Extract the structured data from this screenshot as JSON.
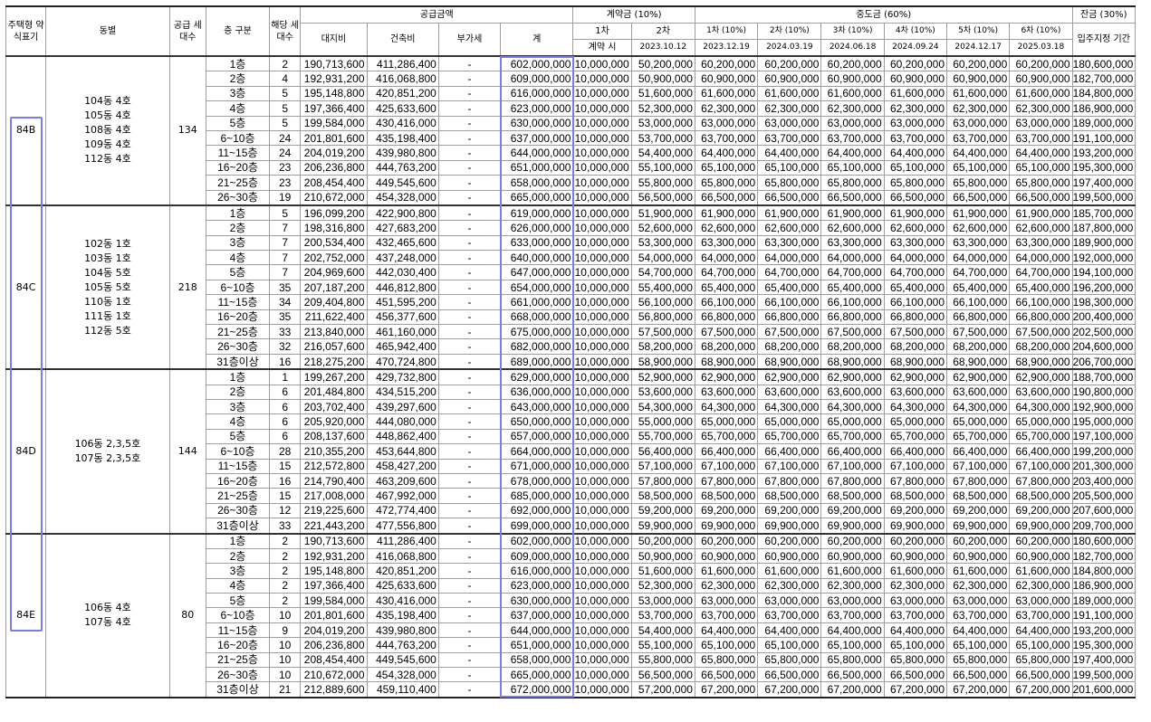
{
  "headers": {
    "type": "주택형 약식표기",
    "dong": "동별",
    "supply_units": "공급 세대수",
    "floor": "층 구분",
    "units": "해당 세대수",
    "supply_price": "공급금액",
    "land": "대지비",
    "building": "건축비",
    "vat": "부가세",
    "total": "계",
    "deposit": "계약금 (10%)",
    "deposit_1": "1차",
    "deposit_1_when": "계약 시",
    "deposit_2": "2차",
    "deposit_2_date": "2023.10.12",
    "interim": "중도금 (60%)",
    "interim_terms": [
      "1차 (10%)",
      "2차 (10%)",
      "3차 (10%)",
      "4차 (10%)",
      "5차 (10%)",
      "6차 (10%)"
    ],
    "interim_dates": [
      "2023.12.19",
      "2024.03.19",
      "2024.06.18",
      "2024.09.24",
      "2024.12.17",
      "2025.03.18"
    ],
    "balance": "잔금 (30%)",
    "balance_when": "입주지정 기간"
  },
  "groups": [
    {
      "type": "84B",
      "dongs": [
        "104동 4호",
        "105동 4호",
        "108동 4호",
        "109동 4호",
        "112동 4호"
      ],
      "supply_units": "134",
      "rows": [
        [
          "1층",
          "2",
          "190,713,600",
          "411,286,400",
          "-",
          "602,000,000",
          "10,000,000",
          "50,200,000",
          "60,200,000",
          "60,200,000",
          "60,200,000",
          "60,200,000",
          "60,200,000",
          "60,200,000",
          "180,600,000"
        ],
        [
          "2층",
          "4",
          "192,931,200",
          "416,068,800",
          "-",
          "609,000,000",
          "10,000,000",
          "50,900,000",
          "60,900,000",
          "60,900,000",
          "60,900,000",
          "60,900,000",
          "60,900,000",
          "60,900,000",
          "182,700,000"
        ],
        [
          "3층",
          "5",
          "195,148,800",
          "420,851,200",
          "-",
          "616,000,000",
          "10,000,000",
          "51,600,000",
          "61,600,000",
          "61,600,000",
          "61,600,000",
          "61,600,000",
          "61,600,000",
          "61,600,000",
          "184,800,000"
        ],
        [
          "4층",
          "5",
          "197,366,400",
          "425,633,600",
          "-",
          "623,000,000",
          "10,000,000",
          "52,300,000",
          "62,300,000",
          "62,300,000",
          "62,300,000",
          "62,300,000",
          "62,300,000",
          "62,300,000",
          "186,900,000"
        ],
        [
          "5층",
          "5",
          "199,584,000",
          "430,416,000",
          "-",
          "630,000,000",
          "10,000,000",
          "53,000,000",
          "63,000,000",
          "63,000,000",
          "63,000,000",
          "63,000,000",
          "63,000,000",
          "63,000,000",
          "189,000,000"
        ],
        [
          "6~10층",
          "24",
          "201,801,600",
          "435,198,400",
          "-",
          "637,000,000",
          "10,000,000",
          "53,700,000",
          "63,700,000",
          "63,700,000",
          "63,700,000",
          "63,700,000",
          "63,700,000",
          "63,700,000",
          "191,100,000"
        ],
        [
          "11~15층",
          "24",
          "204,019,200",
          "439,980,800",
          "-",
          "644,000,000",
          "10,000,000",
          "54,400,000",
          "64,400,000",
          "64,400,000",
          "64,400,000",
          "64,400,000",
          "64,400,000",
          "64,400,000",
          "193,200,000"
        ],
        [
          "16~20층",
          "23",
          "206,236,800",
          "444,763,200",
          "-",
          "651,000,000",
          "10,000,000",
          "55,100,000",
          "65,100,000",
          "65,100,000",
          "65,100,000",
          "65,100,000",
          "65,100,000",
          "65,100,000",
          "195,300,000"
        ],
        [
          "21~25층",
          "23",
          "208,454,400",
          "449,545,600",
          "-",
          "658,000,000",
          "10,000,000",
          "55,800,000",
          "65,800,000",
          "65,800,000",
          "65,800,000",
          "65,800,000",
          "65,800,000",
          "65,800,000",
          "197,400,000"
        ],
        [
          "26~30층",
          "19",
          "210,672,000",
          "454,328,000",
          "-",
          "665,000,000",
          "10,000,000",
          "56,500,000",
          "66,500,000",
          "66,500,000",
          "66,500,000",
          "66,500,000",
          "66,500,000",
          "66,500,000",
          "199,500,000"
        ]
      ]
    },
    {
      "type": "84C",
      "dongs": [
        "102동 1호",
        "103동 1호",
        "104동 5호",
        "105동 5호",
        "110동 1호",
        "111동 1호",
        "112동 5호"
      ],
      "supply_units": "218",
      "rows": [
        [
          "1층",
          "5",
          "196,099,200",
          "422,900,800",
          "-",
          "619,000,000",
          "10,000,000",
          "51,900,000",
          "61,900,000",
          "61,900,000",
          "61,900,000",
          "61,900,000",
          "61,900,000",
          "61,900,000",
          "185,700,000"
        ],
        [
          "2층",
          "7",
          "198,316,800",
          "427,683,200",
          "-",
          "626,000,000",
          "10,000,000",
          "52,600,000",
          "62,600,000",
          "62,600,000",
          "62,600,000",
          "62,600,000",
          "62,600,000",
          "62,600,000",
          "187,800,000"
        ],
        [
          "3층",
          "7",
          "200,534,400",
          "432,465,600",
          "-",
          "633,000,000",
          "10,000,000",
          "53,300,000",
          "63,300,000",
          "63,300,000",
          "63,300,000",
          "63,300,000",
          "63,300,000",
          "63,300,000",
          "189,900,000"
        ],
        [
          "4층",
          "7",
          "202,752,000",
          "437,248,000",
          "-",
          "640,000,000",
          "10,000,000",
          "54,000,000",
          "64,000,000",
          "64,000,000",
          "64,000,000",
          "64,000,000",
          "64,000,000",
          "64,000,000",
          "192,000,000"
        ],
        [
          "5층",
          "7",
          "204,969,600",
          "442,030,400",
          "-",
          "647,000,000",
          "10,000,000",
          "54,700,000",
          "64,700,000",
          "64,700,000",
          "64,700,000",
          "64,700,000",
          "64,700,000",
          "64,700,000",
          "194,100,000"
        ],
        [
          "6~10층",
          "35",
          "207,187,200",
          "446,812,800",
          "-",
          "654,000,000",
          "10,000,000",
          "55,400,000",
          "65,400,000",
          "65,400,000",
          "65,400,000",
          "65,400,000",
          "65,400,000",
          "65,400,000",
          "196,200,000"
        ],
        [
          "11~15층",
          "34",
          "209,404,800",
          "451,595,200",
          "-",
          "661,000,000",
          "10,000,000",
          "56,100,000",
          "66,100,000",
          "66,100,000",
          "66,100,000",
          "66,100,000",
          "66,100,000",
          "66,100,000",
          "198,300,000"
        ],
        [
          "16~20층",
          "35",
          "211,622,400",
          "456,377,600",
          "-",
          "668,000,000",
          "10,000,000",
          "56,800,000",
          "66,800,000",
          "66,800,000",
          "66,800,000",
          "66,800,000",
          "66,800,000",
          "66,800,000",
          "200,400,000"
        ],
        [
          "21~25층",
          "33",
          "213,840,000",
          "461,160,000",
          "-",
          "675,000,000",
          "10,000,000",
          "57,500,000",
          "67,500,000",
          "67,500,000",
          "67,500,000",
          "67,500,000",
          "67,500,000",
          "67,500,000",
          "202,500,000"
        ],
        [
          "26~30층",
          "32",
          "216,057,600",
          "465,942,400",
          "-",
          "682,000,000",
          "10,000,000",
          "58,200,000",
          "68,200,000",
          "68,200,000",
          "68,200,000",
          "68,200,000",
          "68,200,000",
          "68,200,000",
          "204,600,000"
        ],
        [
          "31층이상",
          "16",
          "218,275,200",
          "470,724,800",
          "-",
          "689,000,000",
          "10,000,000",
          "58,900,000",
          "68,900,000",
          "68,900,000",
          "68,900,000",
          "68,900,000",
          "68,900,000",
          "68,900,000",
          "206,700,000"
        ]
      ]
    },
    {
      "type": "84D",
      "dongs": [
        "106동 2,3,5호",
        "107동 2,3,5호"
      ],
      "supply_units": "144",
      "rows": [
        [
          "1층",
          "1",
          "199,267,200",
          "429,732,800",
          "-",
          "629,000,000",
          "10,000,000",
          "52,900,000",
          "62,900,000",
          "62,900,000",
          "62,900,000",
          "62,900,000",
          "62,900,000",
          "62,900,000",
          "188,700,000"
        ],
        [
          "2층",
          "6",
          "201,484,800",
          "434,515,200",
          "-",
          "636,000,000",
          "10,000,000",
          "53,600,000",
          "63,600,000",
          "63,600,000",
          "63,600,000",
          "63,600,000",
          "63,600,000",
          "63,600,000",
          "190,800,000"
        ],
        [
          "3층",
          "6",
          "203,702,400",
          "439,297,600",
          "-",
          "643,000,000",
          "10,000,000",
          "54,300,000",
          "64,300,000",
          "64,300,000",
          "64,300,000",
          "64,300,000",
          "64,300,000",
          "64,300,000",
          "192,900,000"
        ],
        [
          "4층",
          "6",
          "205,920,000",
          "444,080,000",
          "-",
          "650,000,000",
          "10,000,000",
          "55,000,000",
          "65,000,000",
          "65,000,000",
          "65,000,000",
          "65,000,000",
          "65,000,000",
          "65,000,000",
          "195,000,000"
        ],
        [
          "5층",
          "6",
          "208,137,600",
          "448,862,400",
          "-",
          "657,000,000",
          "10,000,000",
          "55,700,000",
          "65,700,000",
          "65,700,000",
          "65,700,000",
          "65,700,000",
          "65,700,000",
          "65,700,000",
          "197,100,000"
        ],
        [
          "6~10층",
          "28",
          "210,355,200",
          "453,644,800",
          "-",
          "664,000,000",
          "10,000,000",
          "56,400,000",
          "66,400,000",
          "66,400,000",
          "66,400,000",
          "66,400,000",
          "66,400,000",
          "66,400,000",
          "199,200,000"
        ],
        [
          "11~15층",
          "15",
          "212,572,800",
          "458,427,200",
          "-",
          "671,000,000",
          "10,000,000",
          "57,100,000",
          "67,100,000",
          "67,100,000",
          "67,100,000",
          "67,100,000",
          "67,100,000",
          "67,100,000",
          "201,300,000"
        ],
        [
          "16~20층",
          "16",
          "214,790,400",
          "463,209,600",
          "-",
          "678,000,000",
          "10,000,000",
          "57,800,000",
          "67,800,000",
          "67,800,000",
          "67,800,000",
          "67,800,000",
          "67,800,000",
          "67,800,000",
          "203,400,000"
        ],
        [
          "21~25층",
          "15",
          "217,008,000",
          "467,992,000",
          "-",
          "685,000,000",
          "10,000,000",
          "58,500,000",
          "68,500,000",
          "68,500,000",
          "68,500,000",
          "68,500,000",
          "68,500,000",
          "68,500,000",
          "205,500,000"
        ],
        [
          "26~30층",
          "12",
          "219,225,600",
          "472,774,400",
          "-",
          "692,000,000",
          "10,000,000",
          "59,200,000",
          "69,200,000",
          "69,200,000",
          "69,200,000",
          "69,200,000",
          "69,200,000",
          "69,200,000",
          "207,600,000"
        ],
        [
          "31층이상",
          "33",
          "221,443,200",
          "477,556,800",
          "-",
          "699,000,000",
          "10,000,000",
          "59,900,000",
          "69,900,000",
          "69,900,000",
          "69,900,000",
          "69,900,000",
          "69,900,000",
          "69,900,000",
          "209,700,000"
        ]
      ]
    },
    {
      "type": "84E",
      "dongs": [
        "106동 4호",
        "107동 4호"
      ],
      "supply_units": "80",
      "rows": [
        [
          "1층",
          "2",
          "190,713,600",
          "411,286,400",
          "-",
          "602,000,000",
          "10,000,000",
          "50,200,000",
          "60,200,000",
          "60,200,000",
          "60,200,000",
          "60,200,000",
          "60,200,000",
          "60,200,000",
          "180,600,000"
        ],
        [
          "2층",
          "2",
          "192,931,200",
          "416,068,800",
          "-",
          "609,000,000",
          "10,000,000",
          "50,900,000",
          "60,900,000",
          "60,900,000",
          "60,900,000",
          "60,900,000",
          "60,900,000",
          "60,900,000",
          "182,700,000"
        ],
        [
          "3층",
          "2",
          "195,148,800",
          "420,851,200",
          "-",
          "616,000,000",
          "10,000,000",
          "51,600,000",
          "61,600,000",
          "61,600,000",
          "61,600,000",
          "61,600,000",
          "61,600,000",
          "61,600,000",
          "184,800,000"
        ],
        [
          "4층",
          "2",
          "197,366,400",
          "425,633,600",
          "-",
          "623,000,000",
          "10,000,000",
          "52,300,000",
          "62,300,000",
          "62,300,000",
          "62,300,000",
          "62,300,000",
          "62,300,000",
          "62,300,000",
          "186,900,000"
        ],
        [
          "5층",
          "2",
          "199,584,000",
          "430,416,000",
          "-",
          "630,000,000",
          "10,000,000",
          "53,000,000",
          "63,000,000",
          "63,000,000",
          "63,000,000",
          "63,000,000",
          "63,000,000",
          "63,000,000",
          "189,000,000"
        ],
        [
          "6~10층",
          "10",
          "201,801,600",
          "435,198,400",
          "-",
          "637,000,000",
          "10,000,000",
          "53,700,000",
          "63,700,000",
          "63,700,000",
          "63,700,000",
          "63,700,000",
          "63,700,000",
          "63,700,000",
          "191,100,000"
        ],
        [
          "11~15층",
          "9",
          "204,019,200",
          "439,980,800",
          "-",
          "644,000,000",
          "10,000,000",
          "54,400,000",
          "64,400,000",
          "64,400,000",
          "64,400,000",
          "64,400,000",
          "64,400,000",
          "64,400,000",
          "193,200,000"
        ],
        [
          "16~20층",
          "10",
          "206,236,800",
          "444,763,200",
          "-",
          "651,000,000",
          "10,000,000",
          "55,100,000",
          "65,100,000",
          "65,100,000",
          "65,100,000",
          "65,100,000",
          "65,100,000",
          "65,100,000",
          "195,300,000"
        ],
        [
          "21~25층",
          "10",
          "208,454,400",
          "449,545,600",
          "-",
          "658,000,000",
          "10,000,000",
          "55,800,000",
          "65,800,000",
          "65,800,000",
          "65,800,000",
          "65,800,000",
          "65,800,000",
          "65,800,000",
          "197,400,000"
        ],
        [
          "26~30층",
          "10",
          "210,672,000",
          "454,328,000",
          "-",
          "665,000,000",
          "10,000,000",
          "56,500,000",
          "66,500,000",
          "66,500,000",
          "66,500,000",
          "66,500,000",
          "66,500,000",
          "66,500,000",
          "199,500,000"
        ],
        [
          "31층이상",
          "21",
          "212,889,600",
          "459,110,400",
          "-",
          "672,000,000",
          "10,000,000",
          "57,200,000",
          "67,200,000",
          "67,200,000",
          "67,200,000",
          "67,200,000",
          "67,200,000",
          "67,200,000",
          "201,600,000"
        ]
      ]
    }
  ],
  "highlight_color": "#7b7ce8"
}
